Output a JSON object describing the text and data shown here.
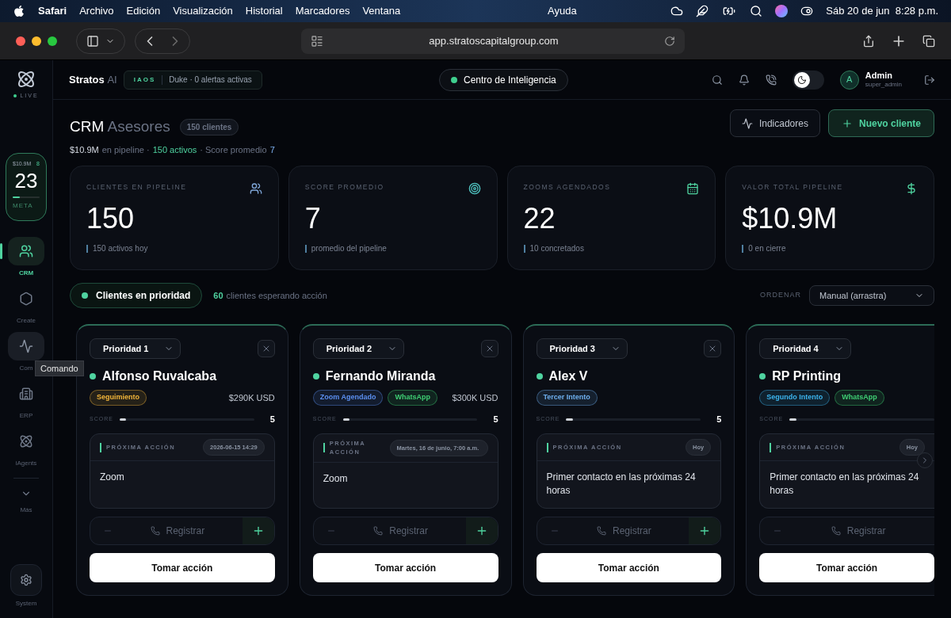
{
  "menubar": {
    "app": "Safari",
    "menus": [
      "Archivo",
      "Edición",
      "Visualización",
      "Historial",
      "Marcadores",
      "Ventana"
    ],
    "center": "Ayuda",
    "clock": "Sáb 20 de jun  8:28 p.m."
  },
  "browser": {
    "url": "app.stratoscapitalgroup.com"
  },
  "sidebar": {
    "status": "LIVE",
    "meta": {
      "amount": "$10.9M",
      "count": "8",
      "value": "23",
      "label": "META",
      "level": 0.25
    },
    "items": [
      {
        "label": "CRM",
        "selected": true,
        "hovered": false
      },
      {
        "label": "Create",
        "selected": false,
        "hovered": false
      },
      {
        "label": "Com",
        "selected": false,
        "hovered": true
      },
      {
        "label": "ERP",
        "selected": false,
        "hovered": false
      },
      {
        "label": "iAgents",
        "selected": false,
        "hovered": false
      }
    ],
    "tooltip": "Comando",
    "more": "Más",
    "system": "System"
  },
  "header": {
    "brand": "Stratos",
    "brand_suffix": "AI",
    "badge_tag": "IAOS",
    "badge_text": "Duke · 0 alertas activas",
    "center": "Centro de Inteligencia",
    "theme_toggle": {
      "on": false
    },
    "user": {
      "initial": "A",
      "name": "Admin",
      "role": "super_admin"
    }
  },
  "page": {
    "title": "CRM",
    "title_suffix": "Asesores",
    "count": "150 clientes",
    "summary": [
      {
        "kind": "figure",
        "text": "$10.9M"
      },
      {
        "kind": "label",
        "text": "en pipeline ·"
      },
      {
        "kind": "active",
        "text": "150 activos"
      },
      {
        "kind": "label",
        "text": "· Score promedio"
      },
      {
        "kind": "score",
        "text": "7"
      }
    ],
    "buttons": [
      {
        "label": "Indicadores",
        "kind": "secondary"
      },
      {
        "label": "Nuevo cliente",
        "kind": "primary"
      }
    ]
  },
  "stats": [
    {
      "label": "CLIENTES EN PIPELINE",
      "value": "150",
      "note": "150 activos hoy"
    },
    {
      "label": "SCORE PROMEDIO",
      "value": "7",
      "note": "promedio del pipeline"
    },
    {
      "label": "ZOOMS AGENDADOS",
      "value": "22",
      "note": "10 concretados"
    },
    {
      "label": "VALOR TOTAL PIPELINE",
      "value": "$10.9M",
      "note": "0 en cierre"
    }
  ],
  "priority": {
    "label": "Clientes en prioridad",
    "count": "60",
    "count_text": "clientes esperando acción",
    "sort_label": "ORDENAR",
    "sort_value": "Manual (arrastra)"
  },
  "cards": [
    {
      "priority": "Prioridad 1",
      "name": "Alfonso Ruvalcaba",
      "tags": [
        {
          "label": "Seguimiento",
          "color": "#f2b53a"
        }
      ],
      "amount": "$290K USD",
      "score_label": "SCORE",
      "score": "5",
      "level": 0.05,
      "action_label": "PRÓXIMA ACCIÓN",
      "date": "2026-06-15 14:29",
      "action": "Zoom",
      "register": "Registrar",
      "cta": "Tomar acción"
    },
    {
      "priority": "Prioridad 2",
      "name": "Fernando Miranda",
      "tags": [
        {
          "label": "Zoom Agendado",
          "color": "#5b8ff0"
        },
        {
          "label": "WhatsApp",
          "color": "#3fcf74"
        }
      ],
      "amount": "$300K USD",
      "score_label": "SCORE",
      "score": "5",
      "level": 0.05,
      "action_label": "PRÓXIMA ACCIÓN",
      "date": "Martes, 16 de junio, 7:00 a.m.",
      "action": "Zoom",
      "register": "Registrar",
      "cta": "Tomar acción"
    },
    {
      "priority": "Prioridad 3",
      "name": "Alex V",
      "tags": [
        {
          "label": "Tercer Intento",
          "color": "#6fb0f0"
        }
      ],
      "score_label": "SCORE",
      "score": "5",
      "level": 0.05,
      "action_label": "PRÓXIMA ACCIÓN",
      "date": "Hoy",
      "action": "Primer contacto en las próximas 24 horas",
      "register": "Registrar",
      "cta": "Tomar acción"
    },
    {
      "priority": "Prioridad 4",
      "name": "RP Printing",
      "tags": [
        {
          "label": "Segundo Intento",
          "color": "#3cb4ee"
        },
        {
          "label": "WhatsApp",
          "color": "#3fcf74"
        }
      ],
      "score_label": "SCORE",
      "level": 0.05,
      "action_label": "PRÓXIMA ACCIÓN",
      "date": "Hoy",
      "action": "Primer contacto en las próximas 24 horas",
      "register": "Registrar",
      "cta": "Tomar acción"
    }
  ]
}
